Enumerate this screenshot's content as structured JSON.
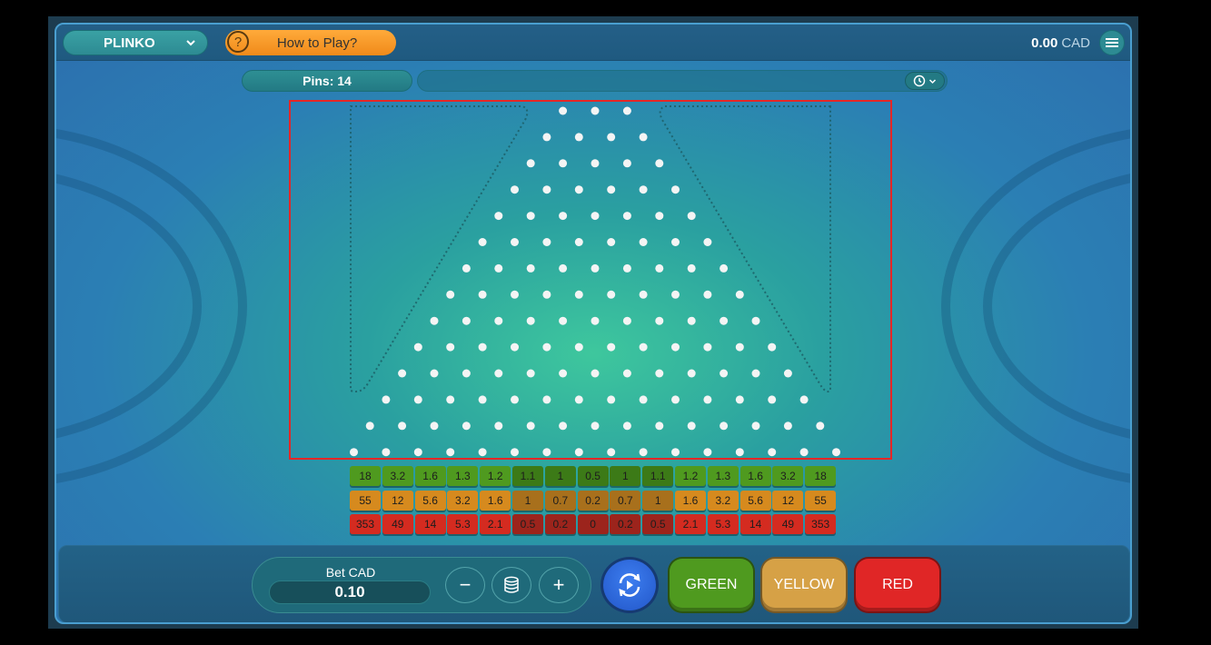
{
  "header": {
    "game_name": "PLINKO",
    "how_to_play": "How to Play?",
    "balance_amount": "0.00",
    "balance_currency": "CAD"
  },
  "board": {
    "pins_label": "Pins: 14",
    "pin_rows": 14,
    "pin_color": "#f4f4f4"
  },
  "multipliers": {
    "green": [
      "18",
      "3.2",
      "1.6",
      "1.3",
      "1.2",
      "1.1",
      "1",
      "0.5",
      "1",
      "1.1",
      "1.2",
      "1.3",
      "1.6",
      "3.2",
      "18"
    ],
    "yellow": [
      "55",
      "12",
      "5.6",
      "3.2",
      "1.6",
      "1",
      "0.7",
      "0.2",
      "0.7",
      "1",
      "1.6",
      "3.2",
      "5.6",
      "12",
      "55"
    ],
    "red": [
      "353",
      "49",
      "14",
      "5.3",
      "2.1",
      "0.5",
      "0.2",
      "0",
      "0.2",
      "0.5",
      "2.1",
      "5.3",
      "14",
      "49",
      "353"
    ],
    "colors": {
      "green": "#4f9a1f",
      "green_dark": "#3c7a17",
      "yellow": "#d68a1e",
      "yellow_dark": "#a8701c",
      "red": "#d42b20",
      "red_dark": "#9c241c"
    }
  },
  "bet": {
    "label": "Bet CAD",
    "value": "0.10",
    "minus": "−",
    "plus": "+"
  },
  "actions": {
    "green_label": "GREEN",
    "yellow_label": "YELLOW",
    "red_label": "RED",
    "green_color": "#4f9a1f",
    "yellow_color": "#d6a146",
    "red_color": "#e02626"
  }
}
